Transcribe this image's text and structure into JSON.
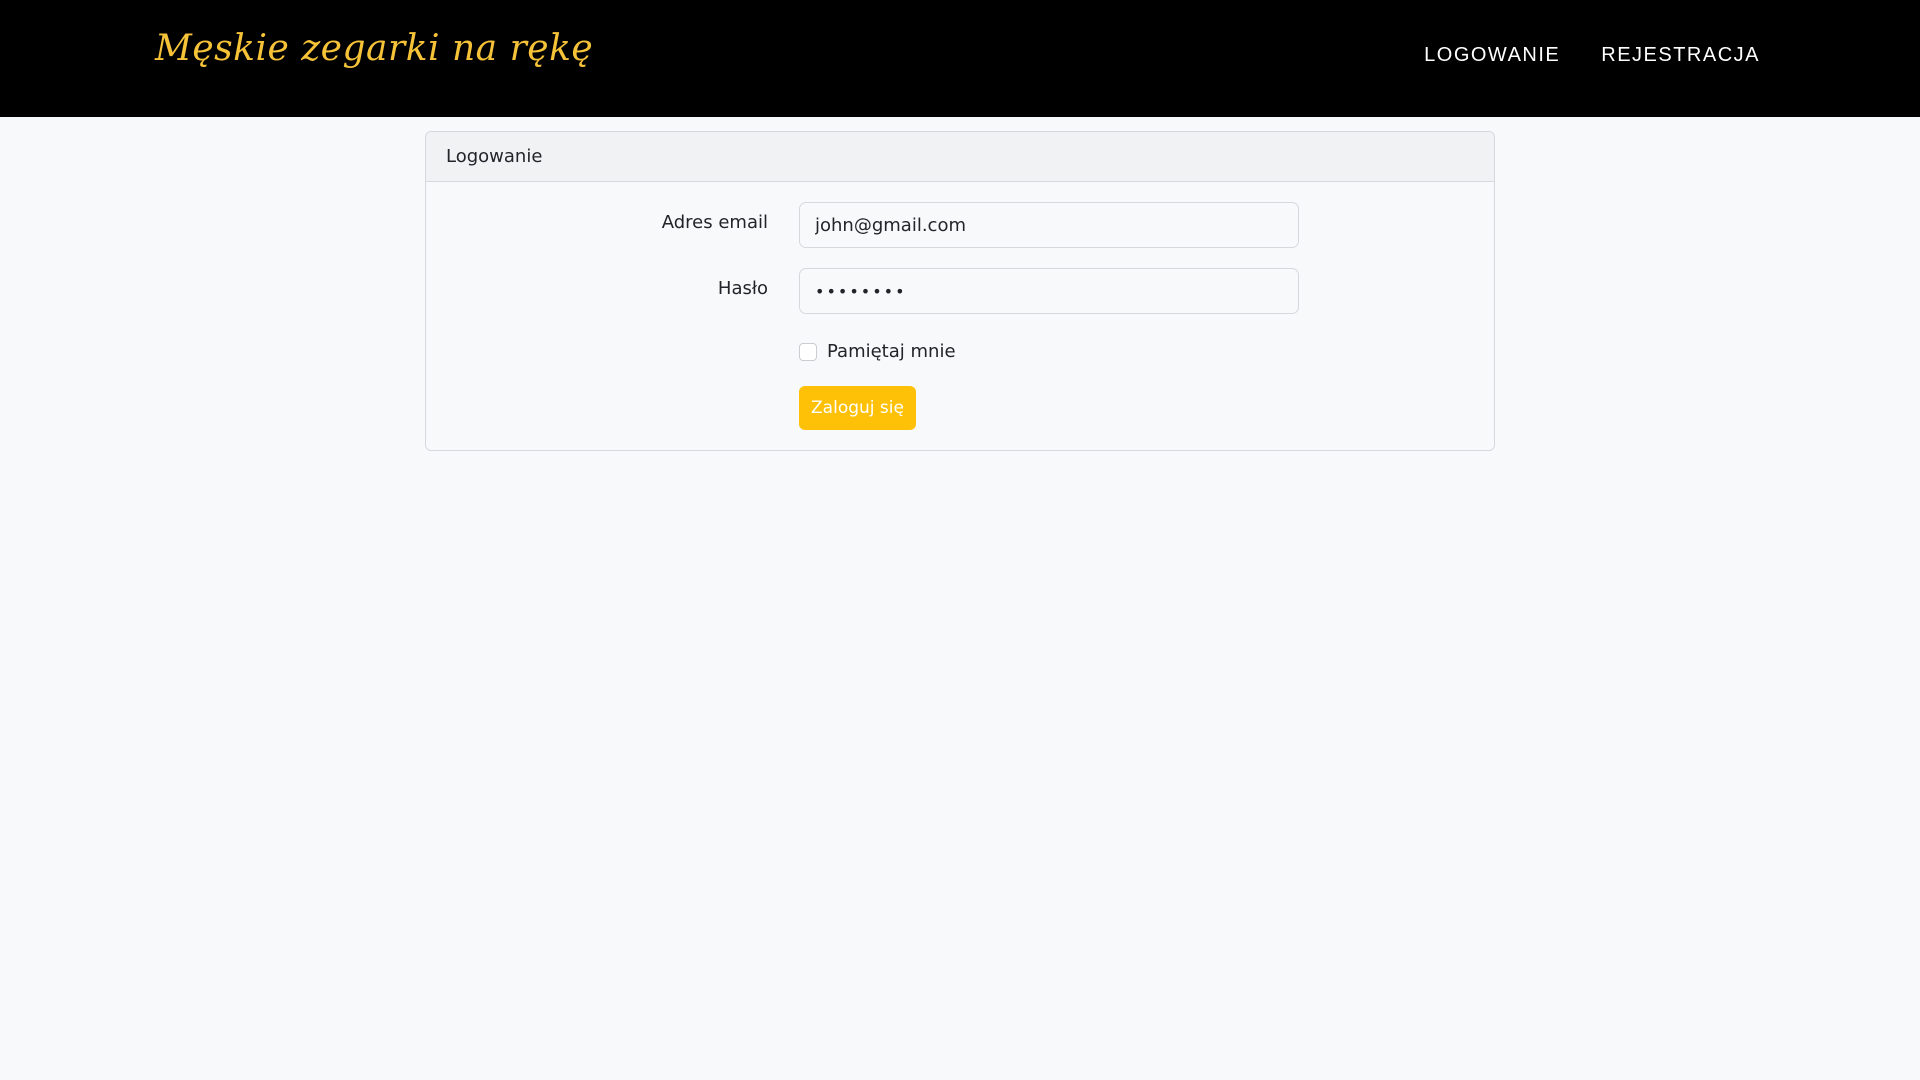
{
  "navbar": {
    "brand": "Męskie zegarki na rękę",
    "links": [
      "LOGOWANIE",
      "REJESTRACJA"
    ],
    "brand_color": "#f5c238",
    "background": "#000000"
  },
  "login_card": {
    "title": "Logowanie",
    "email": {
      "label": "Adres email",
      "value": "john@gmail.com"
    },
    "password": {
      "label": "Hasło",
      "masked_value": "••••••••"
    },
    "remember_me": {
      "label": "Pamiętaj mnie",
      "checked": false
    },
    "submit": {
      "label": "Zaloguj się",
      "color": "#fec107"
    }
  }
}
